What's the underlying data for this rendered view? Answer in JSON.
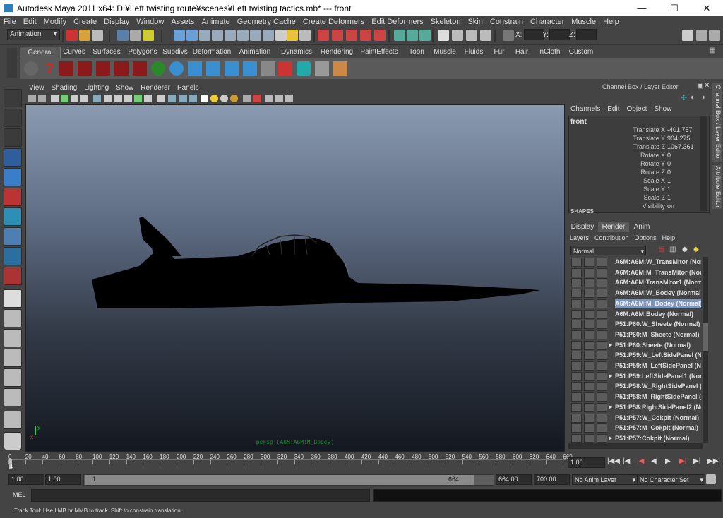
{
  "window": {
    "title": "Autodesk Maya 2011 x64: D:¥Left twisting route¥scenes¥Left twisting tactics.mb*  ---  front",
    "minimize": "—",
    "maximize": "☐",
    "close": "✕"
  },
  "menubar": [
    "File",
    "Edit",
    "Modify",
    "Create",
    "Display",
    "Window",
    "Assets",
    "Animate",
    "Geometry Cache",
    "Create Deformers",
    "Edit Deformers",
    "Skeleton",
    "Skin",
    "Constrain",
    "Character",
    "Muscle",
    "Help"
  ],
  "statusline": {
    "mode_menu": "Animation",
    "x_label": "X:",
    "y_label": "Y:",
    "z_label": "Z:"
  },
  "shelf": {
    "tabs": [
      "General",
      "Curves",
      "Surfaces",
      "Polygons",
      "Subdivs",
      "Deformation",
      "Animation",
      "Dynamics",
      "Rendering",
      "PaintEffects",
      "Toon",
      "Muscle",
      "Fluids",
      "Fur",
      "Hair",
      "nCloth",
      "Custom"
    ],
    "active_tab": "General"
  },
  "viewport": {
    "menus": [
      "View",
      "Shading",
      "Lighting",
      "Show",
      "Renderer",
      "Panels"
    ],
    "camera_label": "persp (A6M:A6M:M_Bodey)",
    "axis_y": "y",
    "axis_x": "x",
    "colors": {
      "axis_y": "#2ecc40",
      "axis_x": "#e53935",
      "label": "#1f8f2f"
    }
  },
  "channel_box": {
    "header": "Channel Box / Layer Editor",
    "menus": [
      "Channels",
      "Edit",
      "Object",
      "Show"
    ],
    "object_name": "front",
    "channels": [
      {
        "label": "Translate X",
        "value": "-401.757"
      },
      {
        "label": "Translate Y",
        "value": "904.275"
      },
      {
        "label": "Translate Z",
        "value": "1067.361"
      },
      {
        "label": "Rotate X",
        "value": "0"
      },
      {
        "label": "Rotate Y",
        "value": "0"
      },
      {
        "label": "Rotate Z",
        "value": "0"
      },
      {
        "label": "Scale X",
        "value": "1"
      },
      {
        "label": "Scale Y",
        "value": "1"
      },
      {
        "label": "Scale Z",
        "value": "1"
      },
      {
        "label": "Visibility",
        "value": "on"
      }
    ],
    "shapes_label": "SHAPES"
  },
  "layer_editor": {
    "tabs": [
      "Display",
      "Render",
      "Anim"
    ],
    "active_tab": "Render",
    "menus": [
      "Layers",
      "Contribution",
      "Options",
      "Help"
    ],
    "mode": "Normal",
    "layers": [
      {
        "name": "A6M:A6M:W_TransMitor (Normal)",
        "selected": false,
        "expander": false
      },
      {
        "name": "A6M:A6M:M_TransMitor (Normal)",
        "selected": false,
        "expander": false
      },
      {
        "name": "A6M:A6M:TransMitor1 (Normal)",
        "selected": false,
        "expander": false
      },
      {
        "name": "A6M:A6M:W_Bodey (Normal)",
        "selected": false,
        "expander": false
      },
      {
        "name": "A6M:A6M:M_Bodey (Normal)",
        "selected": true,
        "expander": false
      },
      {
        "name": "A6M:A6M:Bodey (Normal)",
        "selected": false,
        "expander": false
      },
      {
        "name": "P51:P60:W_Sheete (Normal)",
        "selected": false,
        "expander": false
      },
      {
        "name": "P51:P60:M_Sheete (Normal)",
        "selected": false,
        "expander": false
      },
      {
        "name": "P51:P60:Sheete (Normal)",
        "selected": false,
        "expander": true
      },
      {
        "name": "P51:P59:W_LeftSidePanel (Normal)",
        "selected": false,
        "expander": false
      },
      {
        "name": "P51:P59:M_LeftSidePanel (Normal)",
        "selected": false,
        "expander": false
      },
      {
        "name": "P51:P59:LeftSidePanel1 (Normal)",
        "selected": false,
        "expander": true
      },
      {
        "name": "P51:P58:W_RightSidePanel (Normal)",
        "selected": false,
        "expander": false
      },
      {
        "name": "P51:P58:M_RightSidePanel (Normal)",
        "selected": false,
        "expander": false
      },
      {
        "name": "P51:P58:RightSidePanel2 (Normal)",
        "selected": false,
        "expander": true
      },
      {
        "name": "P51:P57:W_Cokpit (Normal)",
        "selected": false,
        "expander": false
      },
      {
        "name": "P51:P57:M_Cokpit (Normal)",
        "selected": false,
        "expander": false
      },
      {
        "name": "P51:P57:Cokpit (Normal)",
        "selected": false,
        "expander": true
      }
    ]
  },
  "side_tabs": [
    "Channel Box / Layer Editor",
    "Attribute Editor"
  ],
  "timeline": {
    "ticks": [
      "0",
      "20",
      "40",
      "60",
      "80",
      "100",
      "120",
      "140",
      "160",
      "180",
      "200",
      "220",
      "240",
      "260",
      "280",
      "300",
      "320",
      "340",
      "360",
      "380",
      "400",
      "420",
      "440",
      "460",
      "480",
      "500",
      "520",
      "540",
      "560",
      "580",
      "600",
      "620",
      "640",
      "660"
    ],
    "current_frame": "1",
    "current_time_field": "1.00"
  },
  "range": {
    "start": "1.00",
    "playback_start": "1.00",
    "range_start_label": "1",
    "range_end_label": "664",
    "playback_end": "664.00",
    "end": "700.00",
    "anim_layer": "No Anim Layer",
    "character": "No Character Set"
  },
  "mel": {
    "label": "MEL"
  },
  "help_line": "Track Tool: Use LMB or MMB to track. Shift to constrain translation."
}
